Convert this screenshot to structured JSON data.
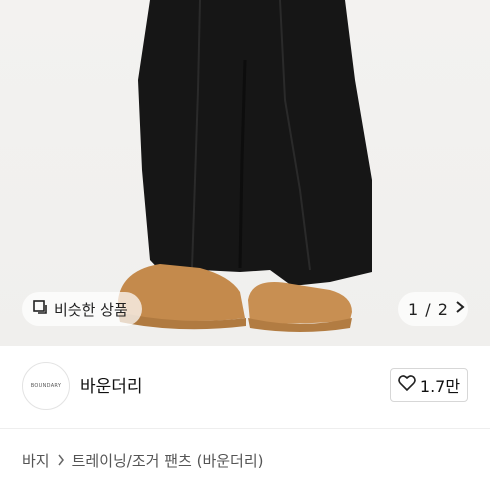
{
  "gallery": {
    "similar_label": "비슷한 상품",
    "similar_icon": "similar-items-icon",
    "page_indicator": "1 / 2",
    "next_icon": "chevron-right-icon"
  },
  "seller": {
    "logo_text": "BOUNDARY",
    "name": "바운더리",
    "like_count": "1.7만",
    "like_icon": "heart-icon"
  },
  "breadcrumb": {
    "category": "바지",
    "subcategory": "트레이닝/조거 팬츠 (바운더리)"
  },
  "product": {
    "title_partial": ""
  },
  "colors": {
    "pants": "#151515",
    "shoes": "#c48a4c",
    "background": "#f2f1ef"
  }
}
